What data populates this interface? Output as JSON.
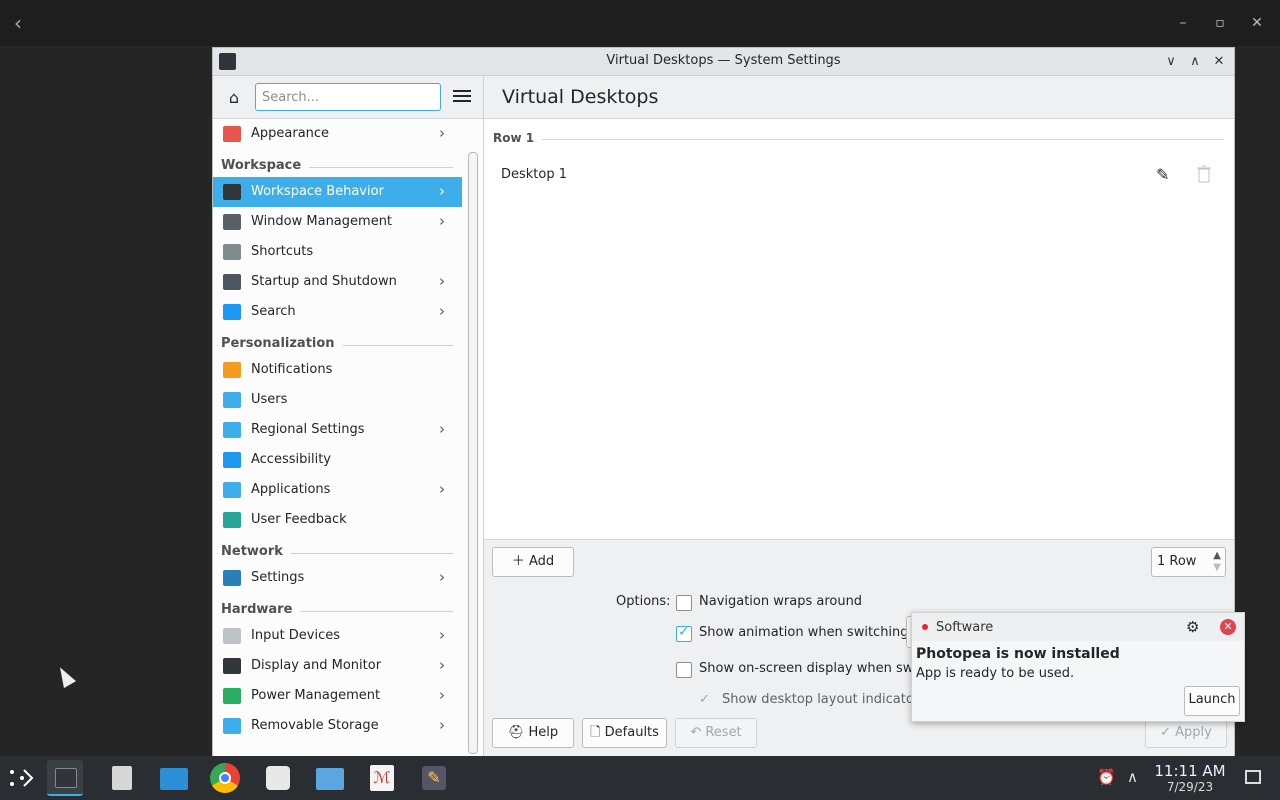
{
  "window": {
    "title": "Virtual Desktops — System Settings",
    "controls": [
      "∨",
      "∧",
      "✕"
    ]
  },
  "topbar": {
    "back_icon": "‹",
    "minimize": "–",
    "maximize": "▫",
    "close": "✕"
  },
  "sidebar": {
    "search_placeholder": "Search...",
    "items": [
      {
        "label": "Appearance",
        "chevron": true,
        "icon_color": "#e8554e"
      },
      {
        "section": "Workspace"
      },
      {
        "label": "Workspace Behavior",
        "chevron": true,
        "selected": true,
        "icon_color": "#31363b"
      },
      {
        "label": "Window Management",
        "chevron": true,
        "icon_color": "#5a6068"
      },
      {
        "label": "Shortcuts",
        "chevron": false,
        "icon_color": "#7f8c8d"
      },
      {
        "label": "Startup and Shutdown",
        "chevron": true,
        "icon_color": "#4d5561"
      },
      {
        "label": "Search",
        "chevron": true,
        "icon_color": "#1d99f3"
      },
      {
        "section": "Personalization"
      },
      {
        "label": "Notifications",
        "chevron": false,
        "icon_color": "#f39c1f"
      },
      {
        "label": "Users",
        "chevron": false,
        "icon_color": "#3daee9"
      },
      {
        "label": "Regional Settings",
        "chevron": true,
        "icon_color": "#3daee9"
      },
      {
        "label": "Accessibility",
        "chevron": false,
        "icon_color": "#1d99f3"
      },
      {
        "label": "Applications",
        "chevron": true,
        "icon_color": "#3daee9"
      },
      {
        "label": "User Feedback",
        "chevron": false,
        "icon_color": "#26a69a"
      },
      {
        "section": "Network"
      },
      {
        "label": "Settings",
        "chevron": true,
        "icon_color": "#2980b9"
      },
      {
        "section": "Hardware"
      },
      {
        "label": "Input Devices",
        "chevron": true,
        "icon_color": "#bdc3c7"
      },
      {
        "label": "Display and Monitor",
        "chevron": true,
        "icon_color": "#31363b"
      },
      {
        "label": "Power Management",
        "chevron": true,
        "icon_color": "#27ae60"
      },
      {
        "label": "Removable Storage",
        "chevron": true,
        "icon_color": "#3daee9"
      }
    ]
  },
  "content": {
    "title": "Virtual Desktops",
    "row_heading": "Row 1",
    "desktops": [
      "Desktop 1"
    ],
    "add_label": "Add",
    "rows_value": "1 Row",
    "options_label": "Options:",
    "options": [
      {
        "label": "Navigation wraps around",
        "checked": false
      },
      {
        "label": "Show animation when switching:",
        "checked": true
      },
      {
        "label": "Show on-screen display when switc",
        "checked": false
      },
      {
        "label": "Show desktop layout indicators",
        "checked": true,
        "dim": true
      }
    ],
    "buttons": {
      "help": "Help",
      "defaults": "Defaults",
      "reset": "Reset",
      "apply": "Apply"
    }
  },
  "notification": {
    "app": "Software",
    "title": "Photopea is now installed",
    "body": "App is ready to be used.",
    "action": "Launch"
  },
  "taskbar": {
    "time": "11:11 AM",
    "date": "7/29/23"
  }
}
